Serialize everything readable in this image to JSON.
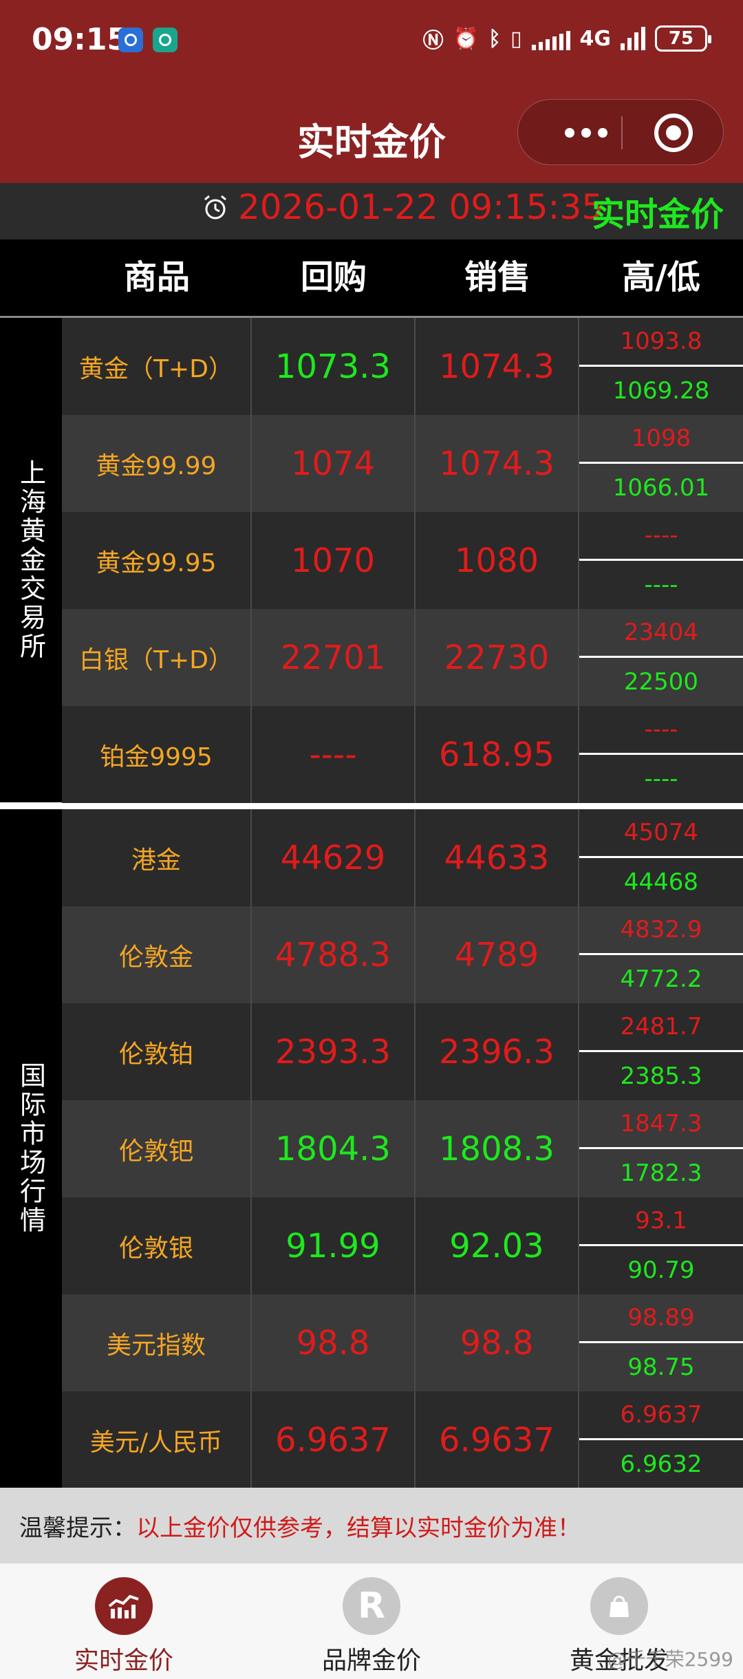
{
  "status_bar": {
    "time": "09:15",
    "network": "4G",
    "battery": "75"
  },
  "header": {
    "title": "实时金价"
  },
  "time_bar": {
    "datetime": "2026-01-22 09:15:35",
    "label": "实时金价"
  },
  "columns": {
    "product": "商品",
    "buy": "回购",
    "sell": "销售",
    "high_low": "高/低"
  },
  "groups": [
    {
      "label": "上海黄金交易所",
      "rows": [
        {
          "name": "黄金（T+D）",
          "buy": "1073.3",
          "buy_trend": "down",
          "sell": "1074.3",
          "sell_trend": "up",
          "high": "1093.8",
          "low": "1069.28"
        },
        {
          "name": "黄金99.99",
          "buy": "1074",
          "buy_trend": "up",
          "sell": "1074.3",
          "sell_trend": "up",
          "high": "1098",
          "low": "1066.01"
        },
        {
          "name": "黄金99.95",
          "buy": "1070",
          "buy_trend": "up",
          "sell": "1080",
          "sell_trend": "up",
          "high": "----",
          "low": "----"
        },
        {
          "name": "白银（T+D）",
          "buy": "22701",
          "buy_trend": "up",
          "sell": "22730",
          "sell_trend": "up",
          "high": "23404",
          "low": "22500"
        },
        {
          "name": "铂金9995",
          "buy": "----",
          "buy_trend": "up",
          "sell": "618.95",
          "sell_trend": "up",
          "high": "----",
          "low": "----"
        }
      ]
    },
    {
      "label": "国际市场行情",
      "rows": [
        {
          "name": "港金",
          "buy": "44629",
          "buy_trend": "up",
          "sell": "44633",
          "sell_trend": "up",
          "high": "45074",
          "low": "44468"
        },
        {
          "name": "伦敦金",
          "buy": "4788.3",
          "buy_trend": "up",
          "sell": "4789",
          "sell_trend": "up",
          "high": "4832.9",
          "low": "4772.2"
        },
        {
          "name": "伦敦铂",
          "buy": "2393.3",
          "buy_trend": "up",
          "sell": "2396.3",
          "sell_trend": "up",
          "high": "2481.7",
          "low": "2385.3"
        },
        {
          "name": "伦敦钯",
          "buy": "1804.3",
          "buy_trend": "down",
          "sell": "1808.3",
          "sell_trend": "down",
          "high": "1847.3",
          "low": "1782.3"
        },
        {
          "name": "伦敦银",
          "buy": "91.99",
          "buy_trend": "down",
          "sell": "92.03",
          "sell_trend": "down",
          "high": "93.1",
          "low": "90.79"
        },
        {
          "name": "美元指数",
          "buy": "98.8",
          "buy_trend": "up",
          "sell": "98.8",
          "sell_trend": "up",
          "high": "98.89",
          "low": "98.75"
        },
        {
          "name": "美元/人民币",
          "buy": "6.9637",
          "buy_trend": "up",
          "sell": "6.9637",
          "sell_trend": "up",
          "high": "6.9637",
          "low": "6.9632"
        }
      ]
    }
  ],
  "notice": {
    "label": "温馨提示：",
    "text": "以上金价仅供参考，结算以实时金价为准！"
  },
  "bottom_nav": [
    {
      "label": "实时金价",
      "icon": "chart-icon",
      "active": true
    },
    {
      "label": "品牌金价",
      "icon": "registered-icon",
      "active": false
    },
    {
      "label": "黄金批发",
      "icon": "bag-icon",
      "active": false
    }
  ],
  "watermark": "@千千荣2599",
  "colors": {
    "brand": "#8b2222",
    "up": "#e11b1b",
    "down": "#1ee81e",
    "name": "#f5a623"
  }
}
